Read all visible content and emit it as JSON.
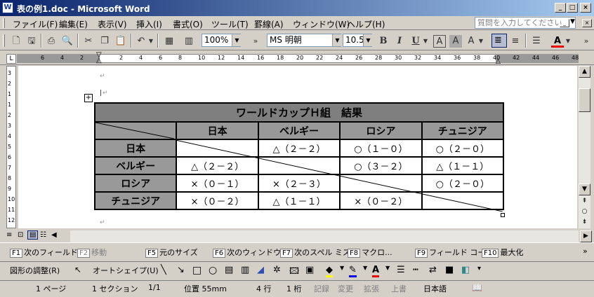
{
  "window": {
    "title": "表の例1.doc - Microsoft Word",
    "app_icon": "W"
  },
  "menu": {
    "items": [
      "ファイル(F)",
      "編集(E)",
      "表示(V)",
      "挿入(I)",
      "書式(O)",
      "ツール(T)",
      "罫線(A)",
      "ウィンドウ(W)",
      "ヘルプ(H)"
    ],
    "help_placeholder": "質問を入力してください"
  },
  "toolbar": {
    "zoom": "100%",
    "font": "MS 明朝",
    "size": "10.5",
    "bold": "B",
    "italic": "I",
    "underline": "U",
    "font_color_a": "A"
  },
  "ruler": {
    "numbers": [
      "6",
      "4",
      "2",
      "2",
      "4",
      "6",
      "8",
      "10",
      "12",
      "14",
      "16",
      "18",
      "20",
      "22",
      "24",
      "26",
      "28",
      "30",
      "32",
      "34",
      "36",
      "38",
      "40",
      "42",
      "44",
      "46",
      "48"
    ]
  },
  "vruler": {
    "numbers": [
      "3",
      "2",
      "1",
      "1",
      "2",
      "3",
      "4",
      "5",
      "6",
      "7",
      "8",
      "9",
      "10",
      "11",
      "12"
    ]
  },
  "table": {
    "title": "ワールドカップＨ組　結果",
    "columns": [
      "日本",
      "ベルギー",
      "ロシア",
      "チュニジア"
    ],
    "rows": [
      {
        "label": "日本",
        "cells": [
          "",
          "△（２－２）",
          "○（１－０）",
          "○（２－０）"
        ]
      },
      {
        "label": "ベルギー",
        "cells": [
          "△（２－２）",
          "",
          "○（３－２）",
          "△（１－１）"
        ]
      },
      {
        "label": "ロシア",
        "cells": [
          "×（０－１）",
          "×（２－３）",
          "",
          "○（２－０）"
        ]
      },
      {
        "label": "チュニジア",
        "cells": [
          "×（０－２）",
          "△（１－１）",
          "×（０－２）",
          ""
        ]
      }
    ]
  },
  "fkeys": [
    {
      "key": "F1",
      "label": "次のフィールド",
      "enabled": true
    },
    {
      "key": "F2",
      "label": "移動",
      "enabled": false
    },
    {
      "key": "F5",
      "label": "元のサイズ",
      "enabled": true
    },
    {
      "key": "F6",
      "label": "次のウィンドウ",
      "enabled": true
    },
    {
      "key": "F7",
      "label": "次のスペル ミス",
      "enabled": true
    },
    {
      "key": "F8",
      "label": "マクロ...",
      "enabled": true
    },
    {
      "key": "F9",
      "label": "フィールド コー...",
      "enabled": true
    },
    {
      "key": "F10",
      "label": "最大化",
      "enabled": true
    }
  ],
  "drawbar": {
    "shape_adjust": "図形の調整(R)",
    "autoshape": "オートシェイプ(U)"
  },
  "status": {
    "page": "1 ページ",
    "section": "1 セクション",
    "pages": "1/1",
    "position": "位置 55mm",
    "line": "4 行",
    "col": "1 桁",
    "rec": "記録",
    "trk": "変更",
    "ext": "拡張",
    "ovr": "上書",
    "lang": "日本語"
  }
}
